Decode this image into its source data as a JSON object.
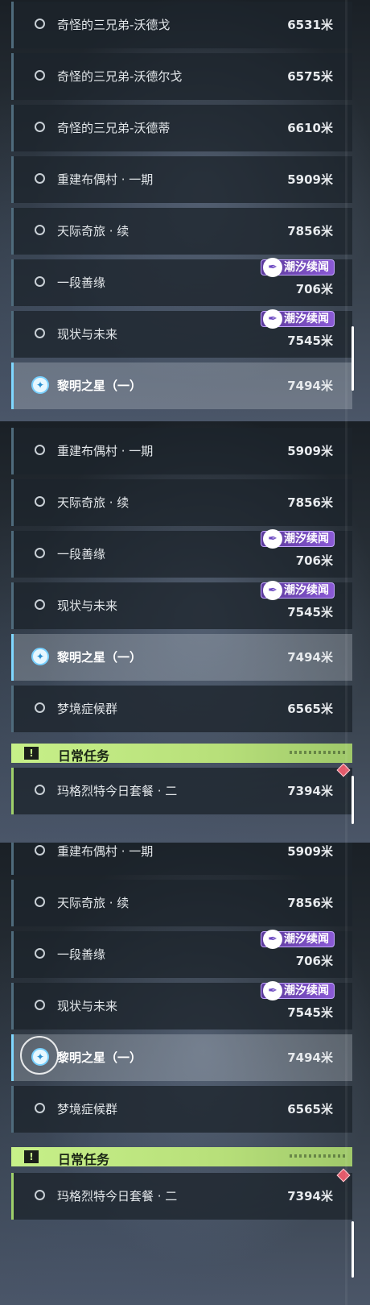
{
  "tag_label": "潮汐续闻",
  "daily_header": "日常任务",
  "screens": [
    {
      "rows": [
        {
          "title": "奇怪的三兄弟-沃德戈",
          "distance": "6531米"
        },
        {
          "title": "奇怪的三兄弟-沃德尔戈",
          "distance": "6575米"
        },
        {
          "title": "奇怪的三兄弟-沃德蒂",
          "distance": "6610米"
        },
        {
          "title": "重建布偶村 · 一期",
          "distance": "5909米"
        },
        {
          "title": "天际奇旅 · 续",
          "distance": "7856米"
        },
        {
          "title": "一段善缘",
          "distance": "706米",
          "tag": true
        },
        {
          "title": "现状与未来",
          "distance": "7545米",
          "tag": true
        },
        {
          "title": "黎明之星（一）",
          "distance": "7494米",
          "active": true
        }
      ]
    },
    {
      "rows": [
        {
          "title": "重建布偶村 · 一期",
          "distance": "5909米"
        },
        {
          "title": "天际奇旅 · 续",
          "distance": "7856米"
        },
        {
          "title": "一段善缘",
          "distance": "706米",
          "tag": true
        },
        {
          "title": "现状与未来",
          "distance": "7545米",
          "tag": true
        },
        {
          "title": "黎明之星（一）",
          "distance": "7494米",
          "active": true
        },
        {
          "title": "梦境症候群",
          "distance": "6565米"
        }
      ],
      "daily": {
        "title": "玛格烈特今日套餐 · 二",
        "distance": "7394米"
      }
    },
    {
      "rows": [
        {
          "title": "重建布偶村 · 一期",
          "distance": "5909米"
        },
        {
          "title": "天际奇旅 · 续",
          "distance": "7856米"
        },
        {
          "title": "一段善缘",
          "distance": "706米",
          "tag": true
        },
        {
          "title": "现状与未来",
          "distance": "7545米",
          "tag": true
        },
        {
          "title": "黎明之星（一）",
          "distance": "7494米",
          "active": true,
          "ring": true
        },
        {
          "title": "梦境症候群",
          "distance": "6565米"
        }
      ],
      "daily": {
        "title": "玛格烈特今日套餐 · 二",
        "distance": "7394米"
      }
    }
  ]
}
